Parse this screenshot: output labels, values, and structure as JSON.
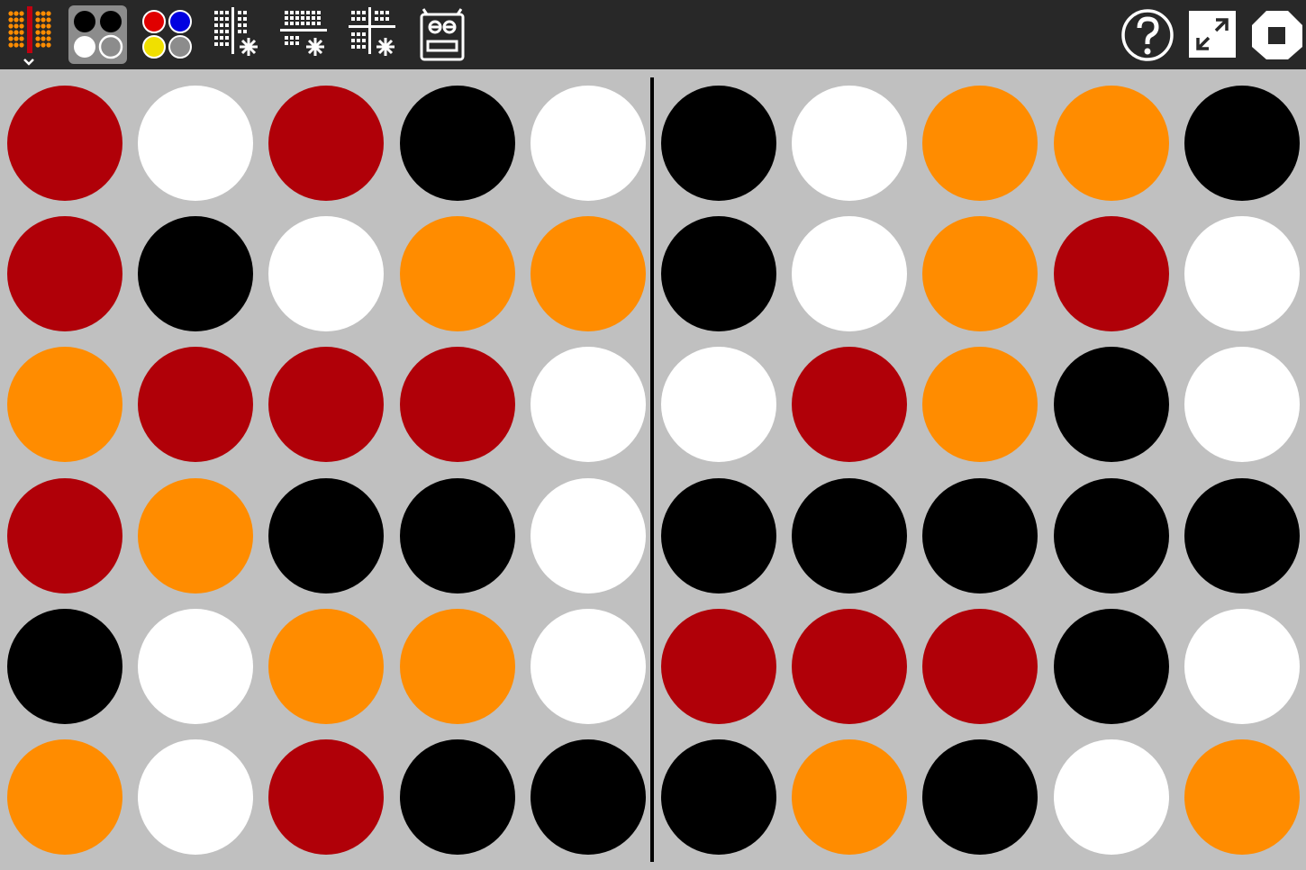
{
  "toolbar": {
    "tools": [
      {
        "name": "board-size-icon",
        "active": false
      },
      {
        "name": "palette-bw-icon",
        "active": true
      },
      {
        "name": "palette-rgby-icon",
        "active": false
      },
      {
        "name": "vertical-split-icon",
        "active": false
      },
      {
        "name": "horizontal-split-icon",
        "active": false
      },
      {
        "name": "quad-split-icon",
        "active": false
      },
      {
        "name": "robot-icon",
        "active": false
      }
    ],
    "right": [
      "help-icon",
      "fullscreen-icon",
      "stop-icon"
    ]
  },
  "colors": {
    "red": "#b00008",
    "white": "#ffffff",
    "black": "#000000",
    "orange": "#ff8c00",
    "toolbar": "#282828",
    "board": "#c0c0c0"
  },
  "board": {
    "rows": 6,
    "cols": 10,
    "split_after_col": 5,
    "cells": [
      [
        "red",
        "white",
        "red",
        "black",
        "white",
        "black",
        "white",
        "orange",
        "orange",
        "black"
      ],
      [
        "red",
        "black",
        "white",
        "orange",
        "orange",
        "black",
        "white",
        "orange",
        "red",
        "white"
      ],
      [
        "orange",
        "red",
        "red",
        "red",
        "white",
        "white",
        "red",
        "orange",
        "black",
        "white"
      ],
      [
        "red",
        "orange",
        "black",
        "black",
        "white",
        "black",
        "black",
        "black",
        "black",
        "black"
      ],
      [
        "black",
        "white",
        "orange",
        "orange",
        "white",
        "red",
        "red",
        "red",
        "black",
        "white"
      ],
      [
        "orange",
        "white",
        "red",
        "black",
        "black",
        "black",
        "orange",
        "black",
        "white",
        "orange"
      ]
    ]
  }
}
